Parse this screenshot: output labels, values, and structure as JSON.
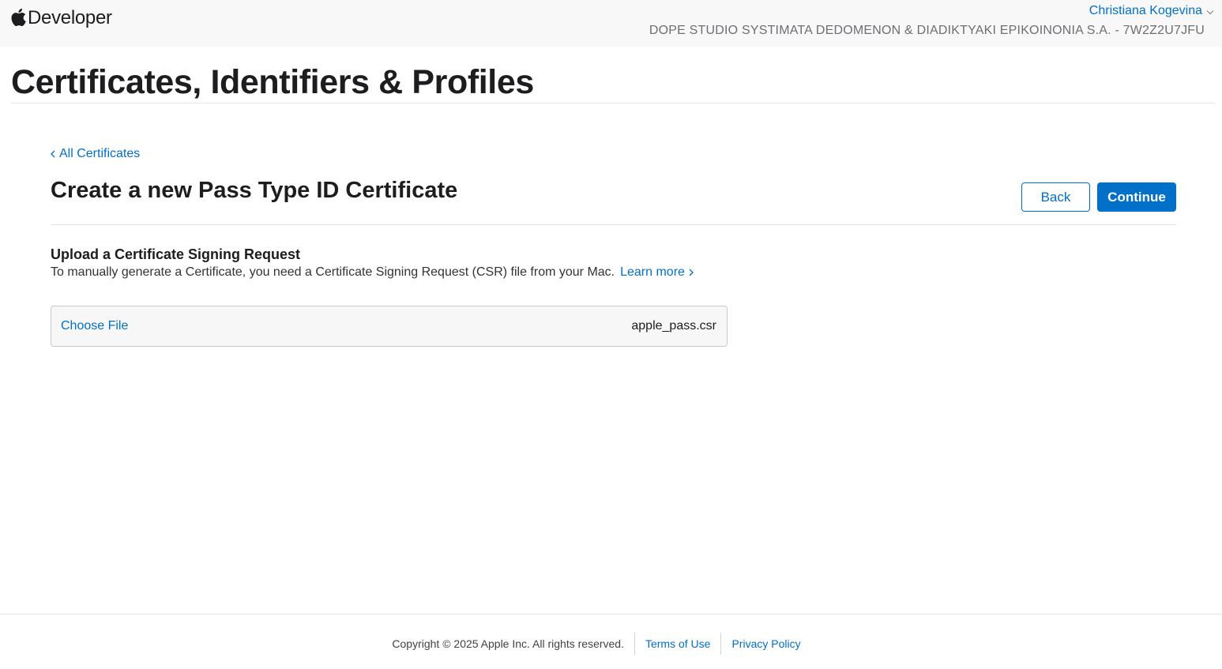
{
  "nav": {
    "brand_label": "Developer",
    "brand_icon": "apple-logo-icon",
    "account_name": "Christiana Kogevina",
    "team_name": "DOPE STUDIO SYSTIMATA DEDOMENON & DIADIKTYAKI EPIKOINONIA S.A. - 7W2Z2U7JFU"
  },
  "page": {
    "title": "Certificates, Identifiers & Profiles"
  },
  "form": {
    "breadcrumb": "All Certificates",
    "title": "Create a new Pass Type ID Certificate",
    "back_label": "Back",
    "continue_label": "Continue",
    "section_title": "Upload a Certificate Signing Request",
    "section_desc": "To manually generate a Certificate, you need a Certificate Signing Request (CSR) file from your Mac.",
    "learn_more": "Learn more",
    "choose_file_label": "Choose File",
    "file_name": "apple_pass.csr"
  },
  "footer": {
    "copyright": "Copyright © 2025 Apple Inc. All rights reserved.",
    "terms": "Terms of Use",
    "privacy": "Privacy Policy"
  },
  "colors": {
    "link": "#0070c9",
    "primary_button": "#0070c9",
    "nav_bg": "#f8f8f8"
  }
}
